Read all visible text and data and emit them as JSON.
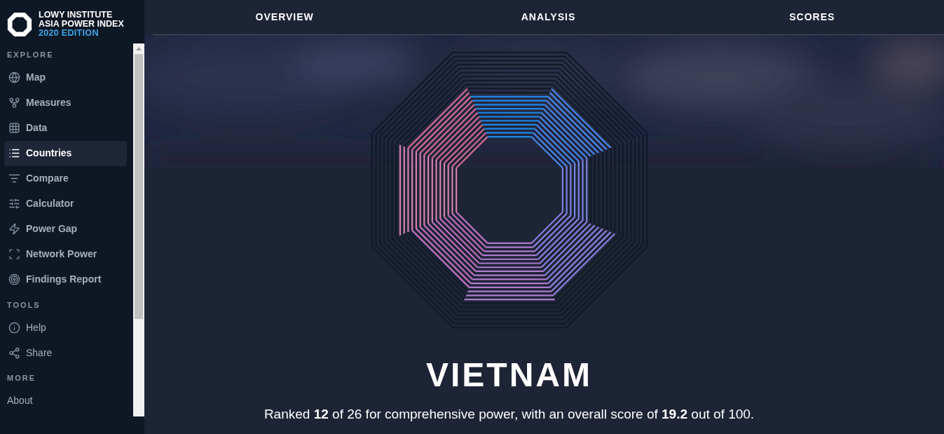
{
  "logo": {
    "lines": [
      "LOWY INSTITUTE",
      "ASIA POWER INDEX"
    ],
    "edition": "2020 EDITION"
  },
  "sidebar": {
    "sections": [
      {
        "heading": "EXPLORE",
        "items": [
          {
            "label": "Map",
            "selected": false
          },
          {
            "label": "Measures",
            "selected": false
          },
          {
            "label": "Data",
            "selected": false
          },
          {
            "label": "Countries",
            "selected": true
          },
          {
            "label": "Compare",
            "selected": false
          },
          {
            "label": "Calculator",
            "selected": false
          },
          {
            "label": "Power Gap",
            "selected": false
          },
          {
            "label": "Network Power",
            "selected": false
          },
          {
            "label": "Findings Report",
            "selected": false
          }
        ]
      },
      {
        "heading": "TOOLS",
        "items": [
          {
            "label": "Help",
            "selected": false
          },
          {
            "label": "Share",
            "selected": false
          }
        ]
      },
      {
        "heading": "MORE",
        "items": [
          {
            "label": "About",
            "selected": false
          }
        ]
      }
    ]
  },
  "tabs": [
    {
      "label": "OVERVIEW"
    },
    {
      "label": "ANALYSIS"
    },
    {
      "label": "SCORES"
    }
  ],
  "octagon": {
    "segments": [
      {
        "color": "#1e88e5"
      },
      {
        "color": "#4a86e8"
      },
      {
        "color": "#7b86e0"
      },
      {
        "color": "#8f7fe0"
      },
      {
        "color": "#b07ad0"
      },
      {
        "color": "#c070c0"
      },
      {
        "color": "#d880b0"
      },
      {
        "color": "#d06a90"
      }
    ]
  },
  "country": "VIETNAM",
  "summary": "Ranked **12** of 26 for comprehensive power, with an overall score of **19.2** out of 100."
}
